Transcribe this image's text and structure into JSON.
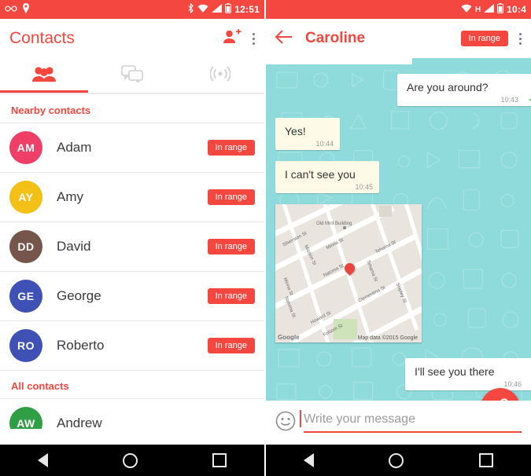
{
  "left": {
    "status_bar": {
      "clock": "12:51",
      "icons": [
        "infinity-icon",
        "pin-icon",
        "bluetooth-icon",
        "wifi-icon",
        "signal-icon",
        "battery-icon"
      ]
    },
    "app_bar": {
      "title": "Contacts",
      "add_contact_icon": "add-person-icon",
      "overflow_icon": "overflow-menu-icon"
    },
    "tabs": [
      {
        "name": "contacts",
        "icon": "people-icon",
        "selected": true
      },
      {
        "name": "chats",
        "icon": "chat-bubbles-icon",
        "selected": false
      },
      {
        "name": "radar",
        "icon": "radar-icon",
        "selected": false
      }
    ],
    "sections": [
      {
        "title": "Nearby contacts",
        "rows": [
          {
            "initials": "AM",
            "name": "Adam",
            "badge": "In range",
            "color": "#ef3e68"
          },
          {
            "initials": "AY",
            "name": "Amy",
            "badge": "In range",
            "color": "#f3c017"
          },
          {
            "initials": "DD",
            "name": "David",
            "badge": "In range",
            "color": "#76554a"
          },
          {
            "initials": "GE",
            "name": "George",
            "badge": "In range",
            "color": "#3f51b5"
          },
          {
            "initials": "RO",
            "name": "Roberto",
            "badge": "In range",
            "color": "#3f51b5"
          }
        ]
      },
      {
        "title": "All contacts",
        "rows": [
          {
            "initials": "AW",
            "name": "Andrew",
            "badge": "",
            "color": "#2f9e44"
          }
        ]
      }
    ],
    "nav": {
      "back": "back-icon",
      "home": "home-icon",
      "recents": "recents-icon"
    }
  },
  "right": {
    "status_bar": {
      "clock": "10:4",
      "icons": [
        "wifi-icon",
        "h-network-icon",
        "signal-icon",
        "battery-icon"
      ]
    },
    "app_bar": {
      "back_icon": "back-arrow-icon",
      "title": "Caroline",
      "range_chip": "In range",
      "overflow_icon": "overflow-menu-icon"
    },
    "messages": [
      {
        "from": "them",
        "text": "Are you around?",
        "time": "10:43",
        "tick": "✓"
      },
      {
        "from": "me",
        "text": "Yes!",
        "time": "10:44",
        "tick": ""
      },
      {
        "from": "me",
        "text": "I can't see you",
        "time": "10:45",
        "tick": ""
      },
      {
        "from": "me",
        "type": "map",
        "attribution": "Map data ©2015 Google",
        "logo": "Google",
        "labels": [
          "Old Mint Building",
          "Silverston St",
          "Mission St",
          "Minna St",
          "Natoma St",
          "Tehama St",
          "Clementina St",
          "Howard St",
          "Shipley St",
          "Folsom St",
          "Minna St",
          "Natoma St",
          "Tehama St"
        ]
      },
      {
        "from": "them",
        "text": "I'll see you there",
        "time": "10:46",
        "tick": ""
      }
    ],
    "composer": {
      "emoji_icon": "emoji-icon",
      "placeholder": "Write your message",
      "attach_icon": "attachment-icon"
    },
    "nav": {
      "back": "back-icon",
      "home": "home-icon",
      "recents": "recents-icon"
    }
  },
  "colors": {
    "accent": "#f4473f",
    "chat_bg": "#8fdbdc",
    "bubble_in": "#fdfbe8",
    "bubble_out": "#ffffff"
  }
}
